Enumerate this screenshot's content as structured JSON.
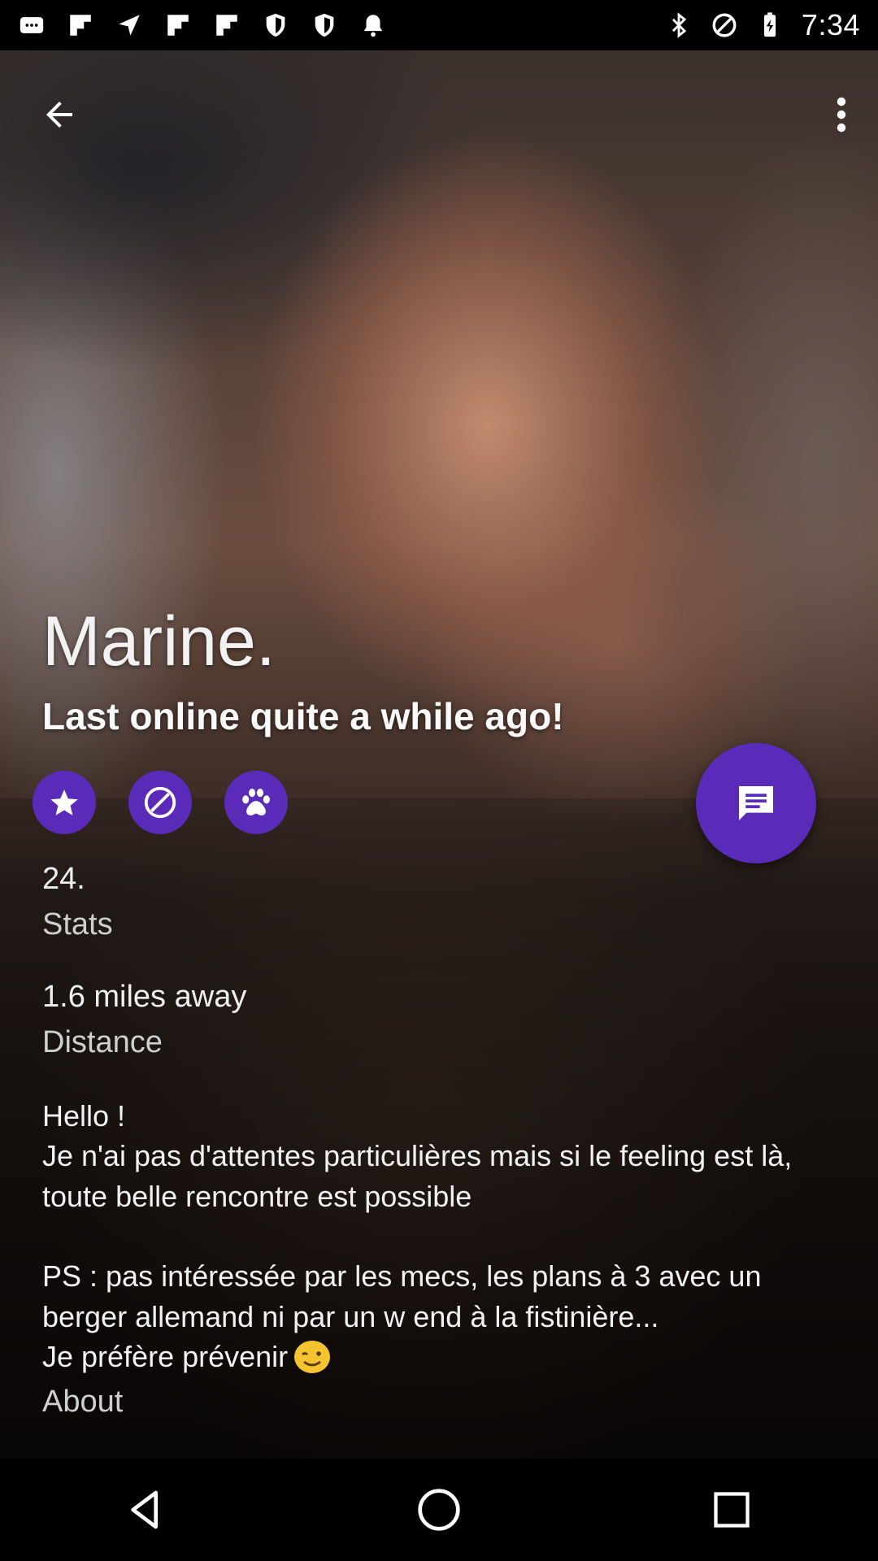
{
  "status_bar": {
    "time": "7:34",
    "left_icons": [
      "message-icon",
      "flipboard-icon",
      "location-icon",
      "flipboard-icon",
      "flipboard-icon",
      "shield-icon",
      "shield-icon",
      "bell-icon"
    ],
    "right_icons": [
      "bluetooth-icon",
      "block-icon",
      "battery-charging-icon"
    ]
  },
  "profile": {
    "name": "Marine.",
    "last_online": "Last online quite a while ago!",
    "age": "24.",
    "age_label": "Stats",
    "distance": "1.6 miles away",
    "distance_label": "Distance",
    "about_text": "Hello !\nJe n'ai pas d'attentes particulières mais si le feeling est là, toute belle rencontre est possible\n\nPS : pas intéressée par les mecs, les plans à 3 avec un berger allemand ni par un w end à la fistinière...\nJe préfère prévenir",
    "about_label": "About"
  },
  "colors": {
    "accent": "#5a2ab8",
    "emoji": "#f4c430"
  }
}
